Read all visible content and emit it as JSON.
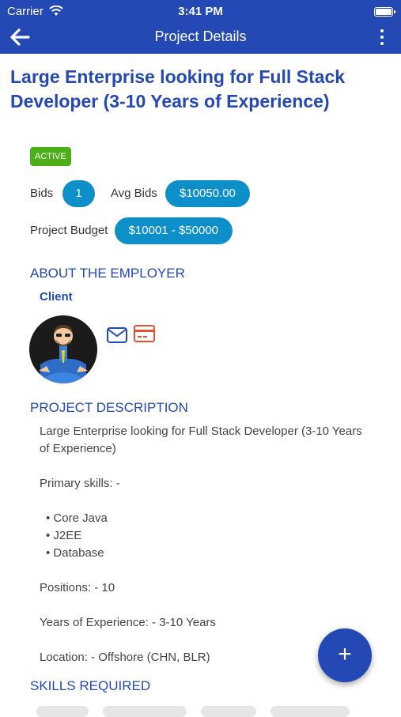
{
  "status_bar": {
    "carrier": "Carrier",
    "time": "3:41 PM"
  },
  "header": {
    "title": "Project Details"
  },
  "project": {
    "title": "Large Enterprise looking for Full Stack Developer (3-10 Years of Experience)",
    "status": "ACTIVE",
    "bids_label": "Bids",
    "bids_value": "1",
    "avg_bids_label": "Avg Bids",
    "avg_bids_value": "$10050.00",
    "budget_label": "Project Budget",
    "budget_value": "$10001 - $50000"
  },
  "employer": {
    "section_title": "ABOUT THE EMPLOYER",
    "name": "Client"
  },
  "description": {
    "section_title": "PROJECT DESCRIPTION",
    "lines": {
      "intro": "Large Enterprise looking for Full Stack Developer (3-10 Years of Experience)",
      "primary_skills": "Primary skills: -",
      "skill1": "• Core Java",
      "skill2": "• J2EE",
      "skill3": "• Database",
      "positions": "Positions: - 10",
      "experience": "Years of Experience: - 3-10 Years",
      "location": "Location: - Offshore (CHN, BLR)"
    }
  },
  "skills": {
    "section_title": "SKILLS REQUIRED"
  },
  "fab": {
    "label": "+"
  },
  "colors": {
    "primary": "#2448b4",
    "pill": "#0d8fc9",
    "active": "#4caf1a",
    "card_icon": "#e8532f"
  }
}
